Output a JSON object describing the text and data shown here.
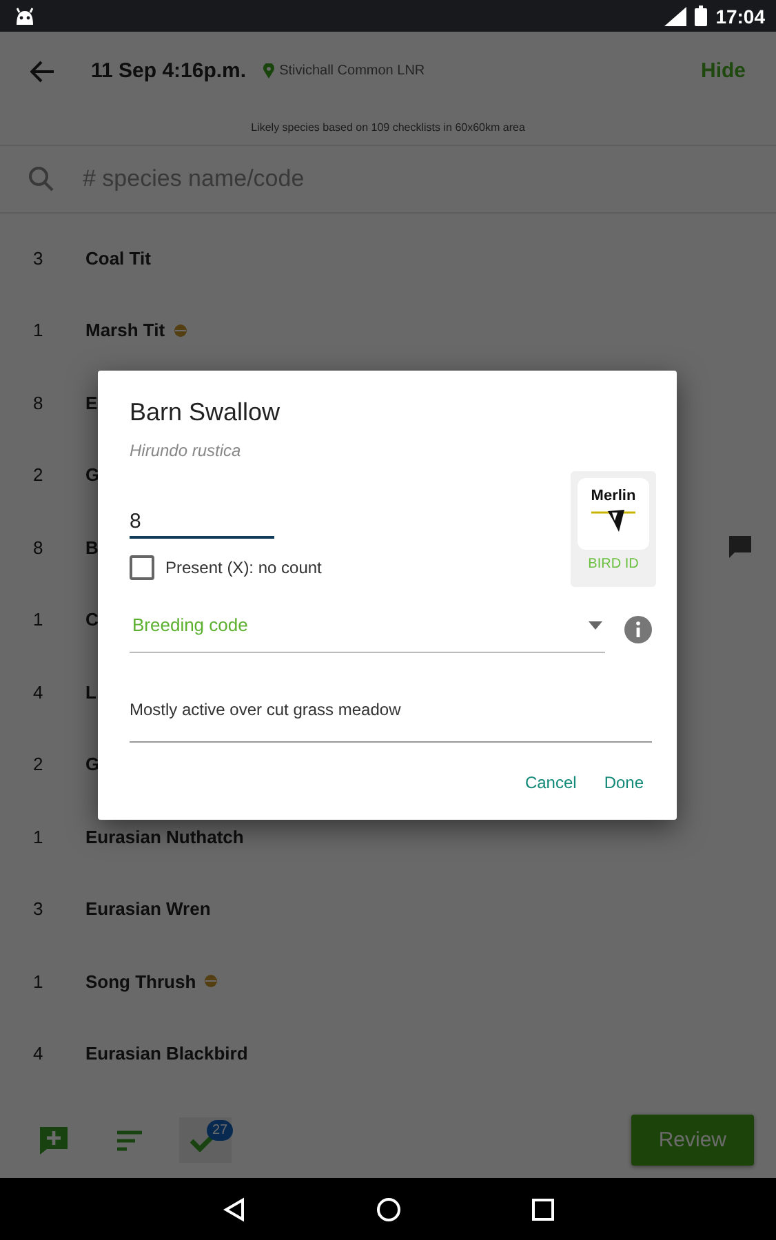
{
  "status_bar": {
    "time": "17:04"
  },
  "header": {
    "date": "11 Sep 4:16p.m.",
    "location": "Stivichall Common LNR",
    "hide": "Hide",
    "subtitle": "Likely species based on 109 checklists in 60x60km area"
  },
  "search": {
    "placeholder": "# species name/code"
  },
  "species": [
    {
      "count": "3",
      "name": "Coal Tit",
      "breeding": false,
      "note": false
    },
    {
      "count": "1",
      "name": "Marsh Tit",
      "breeding": true,
      "note": false
    },
    {
      "count": "8",
      "name": "E",
      "note": false
    },
    {
      "count": "2",
      "name": "G",
      "note": false
    },
    {
      "count": "8",
      "name": "B",
      "note": true
    },
    {
      "count": "1",
      "name": "C",
      "note": false
    },
    {
      "count": "4",
      "name": "L",
      "note": false
    },
    {
      "count": "2",
      "name": "G",
      "note": false
    },
    {
      "count": "1",
      "name": "Eurasian Nuthatch",
      "breeding": false,
      "note": false
    },
    {
      "count": "3",
      "name": "Eurasian Wren",
      "breeding": false,
      "note": false
    },
    {
      "count": "1",
      "name": "Song Thrush",
      "breeding": true,
      "note": false
    },
    {
      "count": "4",
      "name": "Eurasian Blackbird",
      "breeding": false,
      "note": false
    }
  ],
  "bottom_bar": {
    "badge": "27",
    "review": "Review"
  },
  "dialog": {
    "title": "Barn Swallow",
    "scientific_name": "Hirundo rustica",
    "count_value": "8",
    "present": {
      "label": "Present (X): no count",
      "checked": false
    },
    "merlin": {
      "logo": "Merlin",
      "label": "BIRD ID"
    },
    "breeding_code": {
      "placeholder": "Breeding code"
    },
    "comment": "Mostly active over cut grass meadow",
    "buttons": [
      "Cancel",
      "Done"
    ]
  }
}
